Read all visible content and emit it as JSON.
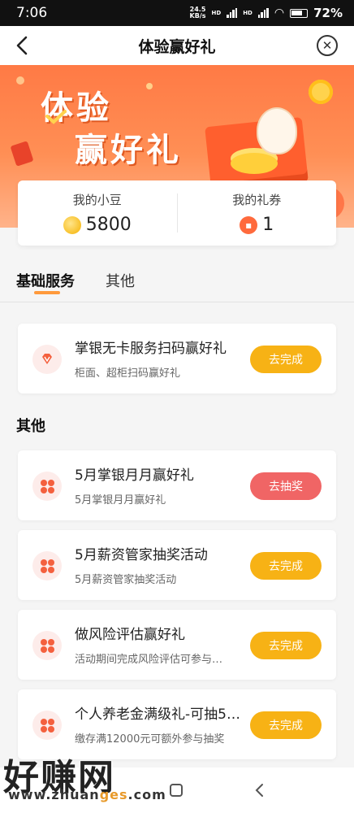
{
  "status": {
    "time": "7:06",
    "speed_top": "24.5",
    "speed_bottom": "KB/s",
    "hd1": "HD",
    "hd2": "HD",
    "battery": "72%"
  },
  "nav": {
    "title": "体验赢好礼",
    "back_icon": "back-arrow-icon",
    "close_icon": "close-circle-icon"
  },
  "banner": {
    "line1": "体验",
    "line2": "赢好礼"
  },
  "summary": {
    "beans_label": "我的小豆",
    "beans_value": "5800",
    "coupons_label": "我的礼券",
    "coupons_value": "1"
  },
  "tabs": [
    {
      "label": "基础服务",
      "active": true
    },
    {
      "label": "其他",
      "active": false
    }
  ],
  "basic_items": [
    {
      "title": "掌银无卡服务扫码赢好礼",
      "subtitle": "柜面、超柜扫码赢好礼",
      "button": "去完成",
      "icon": "diamond-icon"
    }
  ],
  "other_section_title": "其他",
  "other_items": [
    {
      "title": "5月掌银月月赢好礼",
      "subtitle": "5月掌银月月赢好礼",
      "button": "去抽奖",
      "icon": "clover-icon",
      "button_color": "#f06565"
    },
    {
      "title": "5月薪资管家抽奖活动",
      "subtitle": "5月薪资管家抽奖活动",
      "button": "去完成",
      "icon": "clover-icon",
      "button_color": "#f7b215"
    },
    {
      "title": "做风险评估赢好礼",
      "subtitle": "活动期间完成风险评估可参与…",
      "button": "去完成",
      "icon": "clover-icon",
      "button_color": "#f7b215"
    },
    {
      "title": "个人养老金满级礼-可抽5…",
      "subtitle": "缴存满12000元可额外参与抽奖",
      "button": "去完成",
      "icon": "clover-icon",
      "button_color": "#f7b215"
    }
  ],
  "watermark": {
    "main": "好赚网",
    "url_a": "www.zhuan",
    "url_b": "ges",
    "url_c": ".com"
  },
  "colors": {
    "accent": "#ff7a45",
    "button_yellow": "#f7b215",
    "button_red": "#f06565"
  }
}
